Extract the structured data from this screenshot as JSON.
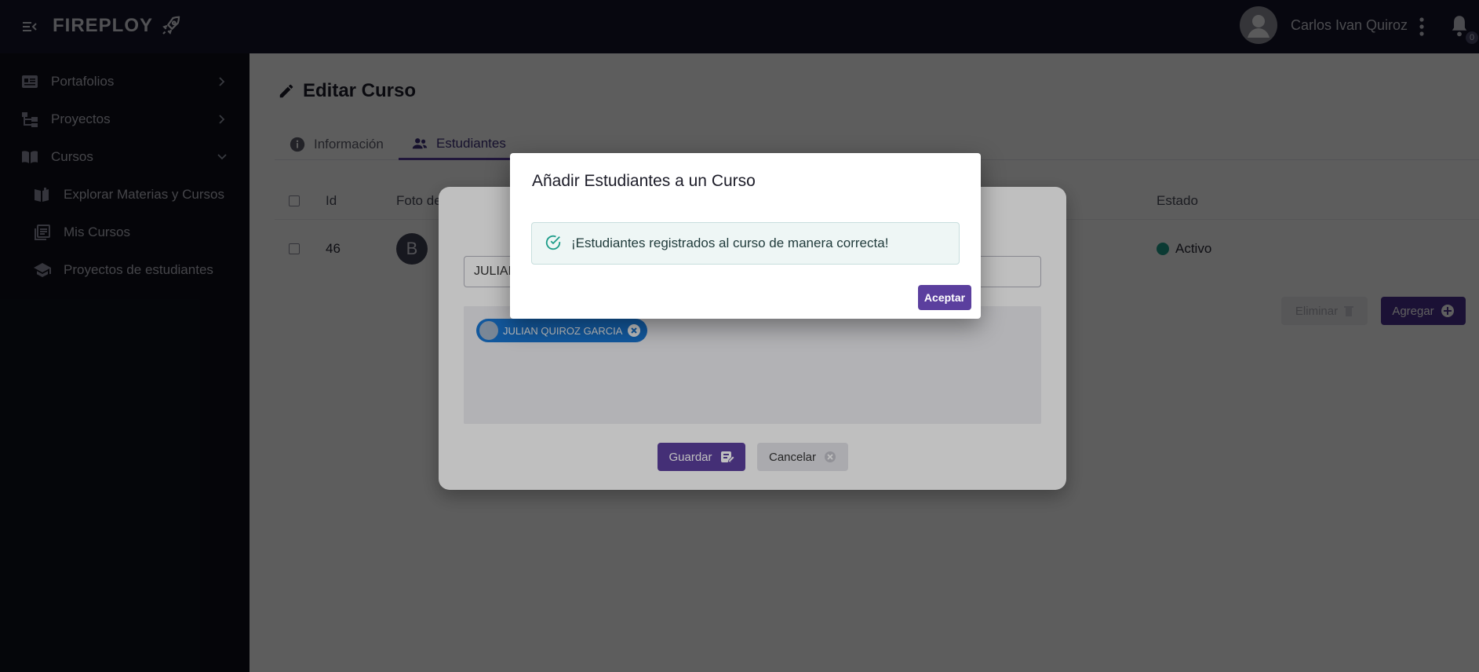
{
  "app": {
    "brand": "FIREPLOY",
    "user_name": "Carlos Ivan Quiroz",
    "notification_count": "0"
  },
  "sidebar": {
    "items": [
      {
        "label": "Portafolios",
        "icon": "portfolio-card-icon",
        "chevron": "right"
      },
      {
        "label": "Proyectos",
        "icon": "project-tree-icon",
        "chevron": "right"
      },
      {
        "label": "Cursos",
        "icon": "book-icon",
        "chevron": "down"
      },
      {
        "label": "Explorar Materias y Cursos",
        "icon": "book-open-icon"
      },
      {
        "label": "Mis Cursos",
        "icon": "library-icon"
      },
      {
        "label": "Proyectos de estudiantes",
        "icon": "graduation-cap-icon"
      }
    ]
  },
  "page": {
    "title": "Editar Curso",
    "tabs": [
      {
        "label": "Información",
        "active": false
      },
      {
        "label": "Estudiantes",
        "active": true
      }
    ]
  },
  "table": {
    "headers": {
      "id": "Id",
      "photo": "Foto de",
      "estado": "Estado"
    },
    "rows": [
      {
        "id": "46",
        "photo_initial": "B",
        "estado": "Activo"
      }
    ]
  },
  "actions": {
    "eliminar": "Eliminar",
    "agregar": "Agregar"
  },
  "student_modal": {
    "search_value": "JULIAN",
    "selected_chip": "JULIAN QUIROZ GARCIA",
    "guardar": "Guardar",
    "cancelar": "Cancelar"
  },
  "dialog": {
    "title": "Añadir Estudiantes a un Curso",
    "message": "¡Estudiantes registrados al curso de manera correcta!",
    "accept": "Aceptar"
  },
  "colors": {
    "primary": "#5b3f9e",
    "topbar": "#14152a",
    "sidebar": "#0e0f1a",
    "success_dot": "#1f9d8a",
    "chip": "#1976d2"
  }
}
